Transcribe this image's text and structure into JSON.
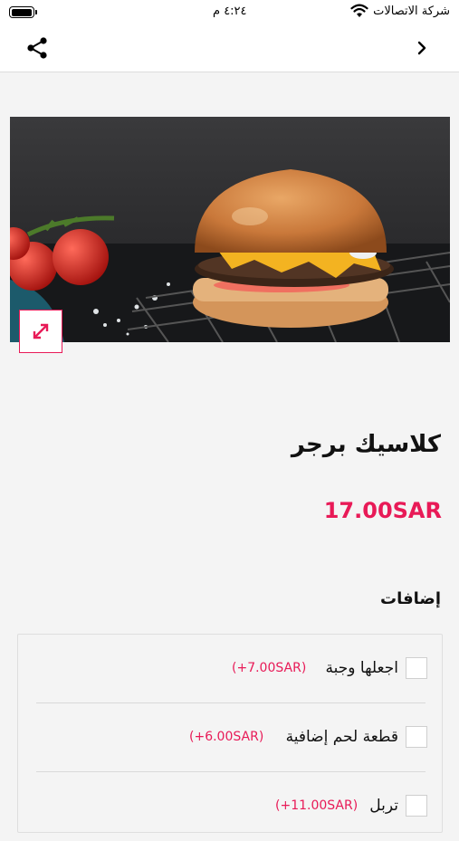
{
  "status_bar": {
    "carrier": "شركة الاتصالات",
    "time": "٤:٢٤ م",
    "battery_level": 0.9,
    "wifi_icon": "wifi-icon",
    "battery_icon": "battery-icon"
  },
  "navbar": {
    "share_icon": "share-icon",
    "back_icon": "chevron-right-icon"
  },
  "product": {
    "image_description_icon": "burger-photo",
    "expand_icon": "expand-icon",
    "name": "كلاسيك برجر",
    "price": "17.00SAR"
  },
  "addons": {
    "title": "إضافات",
    "items": [
      {
        "name": "اجعلها وجبة",
        "price": "(+7.00SAR)",
        "checked": false
      },
      {
        "name": "قطعة لحم إضافية",
        "price": "(+6.00SAR)",
        "checked": false
      },
      {
        "name": "تربل",
        "price": "(+11.00SAR)",
        "checked": false
      }
    ]
  },
  "colors": {
    "accent": "#e81a57",
    "background": "#f4f4f4"
  }
}
